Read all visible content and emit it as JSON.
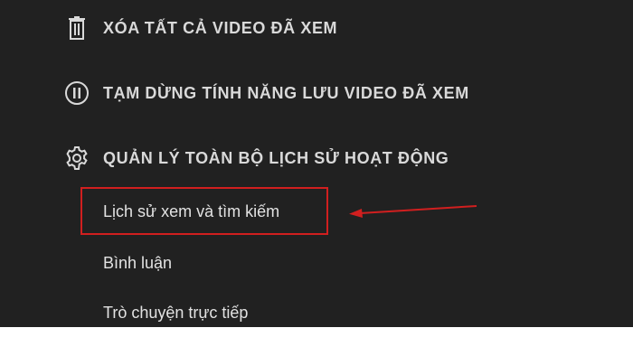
{
  "menu": {
    "clear_all": {
      "label": "XÓA TẤT CẢ VIDEO ĐÃ XEM",
      "icon": "trash-icon"
    },
    "pause": {
      "label": "TẠM DỪNG TÍNH NĂNG LƯU VIDEO ĐÃ XEM",
      "icon": "pause-circle-icon"
    },
    "manage": {
      "label": "QUẢN LÝ TOÀN BỘ LỊCH SỬ HOẠT ĐỘNG",
      "icon": "gear-icon"
    }
  },
  "submenu": {
    "history": "Lịch sử xem và tìm kiếm",
    "comments": "Bình luận",
    "live_chat": "Trò chuyện trực tiếp"
  },
  "annotation": {
    "highlight_color": "#d11f1f",
    "arrow_color": "#d11f1f"
  },
  "colors": {
    "background": "#212121",
    "text": "#d9d9d9"
  }
}
